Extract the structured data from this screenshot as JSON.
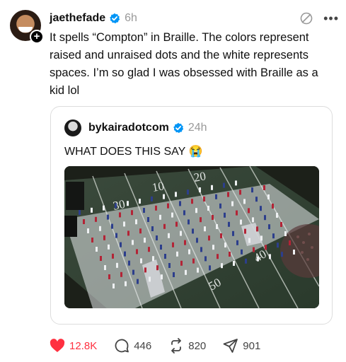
{
  "post": {
    "username": "jaethefade",
    "time": "6h",
    "text": "It spells “Compton” in Braille. The colors represent raised and unraised dots and the white represents spaces. I’m so glad I was obsessed with Braille as a kid lol"
  },
  "quote": {
    "username": "bykairadotcom",
    "time": "24h",
    "text": "WHAT DOES THIS SAY 😭",
    "media_labels": {
      "yard_10": "10",
      "yard_20": "20",
      "yard_30": "30",
      "yard_40": "40",
      "yard_50": "50"
    }
  },
  "actions": {
    "likes": "12.8K",
    "replies": "446",
    "reposts": "820",
    "shares": "901"
  },
  "colors": {
    "like": "#ff3040",
    "verified": "#0095f6",
    "muted_text": "#999999"
  },
  "icons": [
    "plus-icon",
    "verified-badge-icon",
    "mute-icon",
    "more-icon",
    "heart-icon",
    "reply-icon",
    "repost-icon",
    "share-icon"
  ]
}
